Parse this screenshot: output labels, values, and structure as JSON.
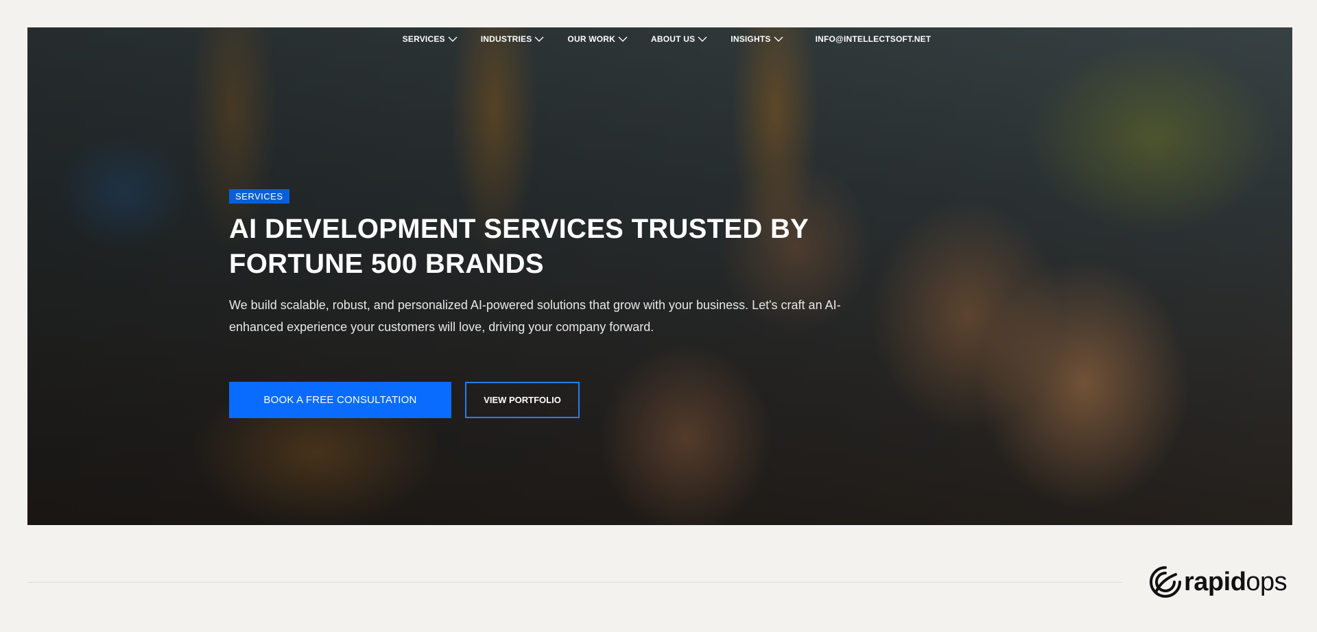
{
  "nav": {
    "items": [
      {
        "label": "SERVICES"
      },
      {
        "label": "INDUSTRIES"
      },
      {
        "label": "OUR WORK"
      },
      {
        "label": "ABOUT US"
      },
      {
        "label": "INSIGHTS"
      }
    ],
    "email": "INFO@INTELLECTSOFT.NET"
  },
  "hero": {
    "badge": "SERVICES",
    "title": "AI DEVELOPMENT SERVICES TRUSTED BY FORTUNE 500 BRANDS",
    "subtitle": "We build scalable, robust, and personalized AI-powered solutions that grow with your business. Let's craft an AI-enhanced experience your customers will love, driving your company forward.",
    "primary_button": "BOOK A FREE CONSULTATION",
    "secondary_button": "VIEW PORTFOLIO"
  },
  "footer": {
    "logo_bold": "rapid",
    "logo_light": "ops"
  },
  "colors": {
    "accent": "#0a6cff",
    "badge": "#0a5fd6",
    "background": "#f3f2ee"
  }
}
